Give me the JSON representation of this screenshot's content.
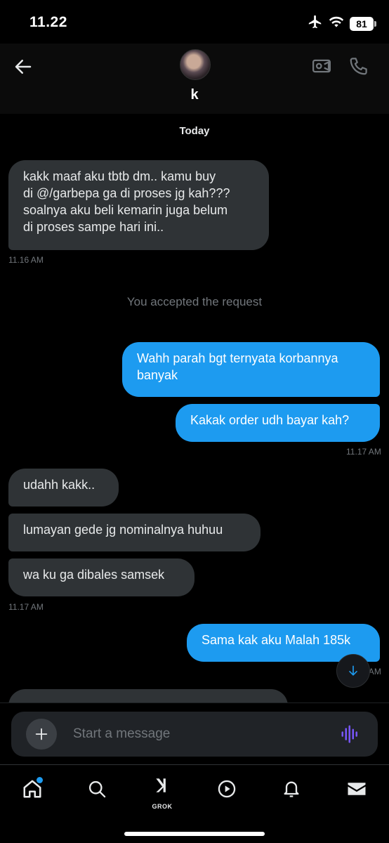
{
  "status": {
    "time": "11.22",
    "battery": "81"
  },
  "header": {
    "contact_name": "k"
  },
  "chat": {
    "day": "Today",
    "system": "You accepted the request",
    "messages": [
      {
        "dir": "in",
        "text": "kakk maaf aku tbtb dm.. kamu buy\ndi @/garbepa ga di proses jg kah???\nsoalnya aku beli kemarin juga belum\ndi proses sampe hari ini.."
      },
      {
        "dir": "out",
        "text": "Wahh parah bgt ternyata korbannya\nbanyak"
      },
      {
        "dir": "out",
        "text": "Kakak order udh bayar kah?"
      },
      {
        "dir": "in",
        "text": "udahh kakk.."
      },
      {
        "dir": "in",
        "text": "lumayan gede jg nominalnya huhuu"
      },
      {
        "dir": "in",
        "text": "wa ku ga dibales samsek"
      },
      {
        "dir": "out",
        "text": "Sama kak aku Malah 185k"
      }
    ],
    "timestamps": [
      "11.16 AM",
      "11.17 AM",
      "11.17 AM",
      "11.17 AM"
    ]
  },
  "composer": {
    "placeholder": "Start a message"
  },
  "tabbar": {
    "grok_label": "GROK"
  },
  "colors": {
    "accent": "#1d9bf0",
    "incoming": "#2f3336",
    "voice": "#7856ff"
  }
}
